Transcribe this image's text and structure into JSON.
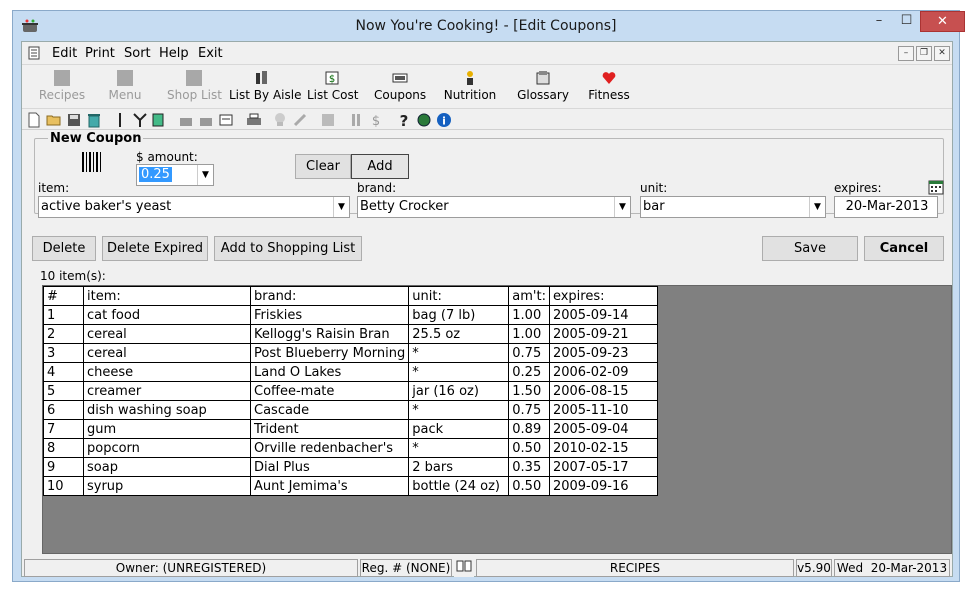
{
  "window": {
    "title": "Now You're Cooking! - [Edit Coupons]",
    "minimize": "–",
    "maximize": "☐",
    "close": "✕"
  },
  "menu": {
    "items": [
      "Edit",
      "Print",
      "Sort",
      "Help",
      "Exit"
    ],
    "mdi_min": "–",
    "mdi_restore": "❐",
    "mdi_close": "✕"
  },
  "toolbar": {
    "buttons": [
      {
        "label": "Recipes",
        "enabled": false
      },
      {
        "label": "Menu",
        "enabled": false
      },
      {
        "label": "Shop List",
        "enabled": false
      },
      {
        "label": "List By Aisle",
        "enabled": true
      },
      {
        "label": "List Cost",
        "enabled": true
      },
      {
        "label": "Coupons",
        "enabled": true
      },
      {
        "label": "Nutrition",
        "enabled": true
      },
      {
        "label": "Glossary",
        "enabled": true
      },
      {
        "label": "Fitness",
        "enabled": true
      }
    ]
  },
  "coupon": {
    "legend": "New Coupon",
    "amount_label": "$ amount:",
    "amount_value": "0.25",
    "item_label": "item:",
    "item_value": "active baker's yeast",
    "brand_label": "brand:",
    "brand_value": "Betty Crocker",
    "unit_label": "unit:",
    "unit_value": "bar",
    "expires_label": "expires:",
    "expires_value": "20-Mar-2013",
    "clear_label": "Clear",
    "add_label": "Add"
  },
  "actions": {
    "delete_label": "Delete",
    "delete_expired_label": "Delete Expired",
    "add_to_list_label": "Add to Shopping List",
    "save_label": "Save",
    "cancel_label": "Cancel"
  },
  "table": {
    "count_label": "10 item(s):",
    "columns": [
      "#",
      "item:",
      "brand:",
      "unit:",
      "am't:",
      "expires:"
    ],
    "rows": [
      [
        "1",
        "cat food",
        "Friskies",
        "bag (7 lb)",
        "1.00",
        "2005-09-14"
      ],
      [
        "2",
        "cereal",
        "Kellogg's Raisin Bran",
        "25.5 oz",
        "1.00",
        "2005-09-21"
      ],
      [
        "3",
        "cereal",
        "Post Blueberry Morning",
        "*",
        "0.75",
        "2005-09-23"
      ],
      [
        "4",
        "cheese",
        "Land O Lakes",
        "*",
        "0.25",
        "2006-02-09"
      ],
      [
        "5",
        "creamer",
        "Coffee-mate",
        "jar (16 oz)",
        "1.50",
        "2006-08-15"
      ],
      [
        "6",
        "dish washing soap",
        "Cascade",
        "*",
        "0.75",
        "2005-11-10"
      ],
      [
        "7",
        "gum",
        "Trident",
        "pack",
        "0.89",
        "2005-09-04"
      ],
      [
        "8",
        "popcorn",
        "Orville redenbacher's",
        "*",
        "0.50",
        "2010-02-15"
      ],
      [
        "9",
        "soap",
        "Dial Plus",
        "2 bars",
        "0.35",
        "2007-05-17"
      ],
      [
        "10",
        "syrup",
        "Aunt Jemima's",
        "bottle (24 oz)",
        "0.50",
        "2009-09-16"
      ]
    ]
  },
  "status": {
    "owner": "Owner: (UNREGISTERED)",
    "reg": "Reg. # (NONE)",
    "section": "RECIPES",
    "version": "v5.90",
    "day": "Wed",
    "date": "20-Mar-2013"
  },
  "colors": {
    "window_frame": "#c6dcf2",
    "selection": "#3399ff",
    "grid_bg": "#808080",
    "close": "#c75050"
  }
}
